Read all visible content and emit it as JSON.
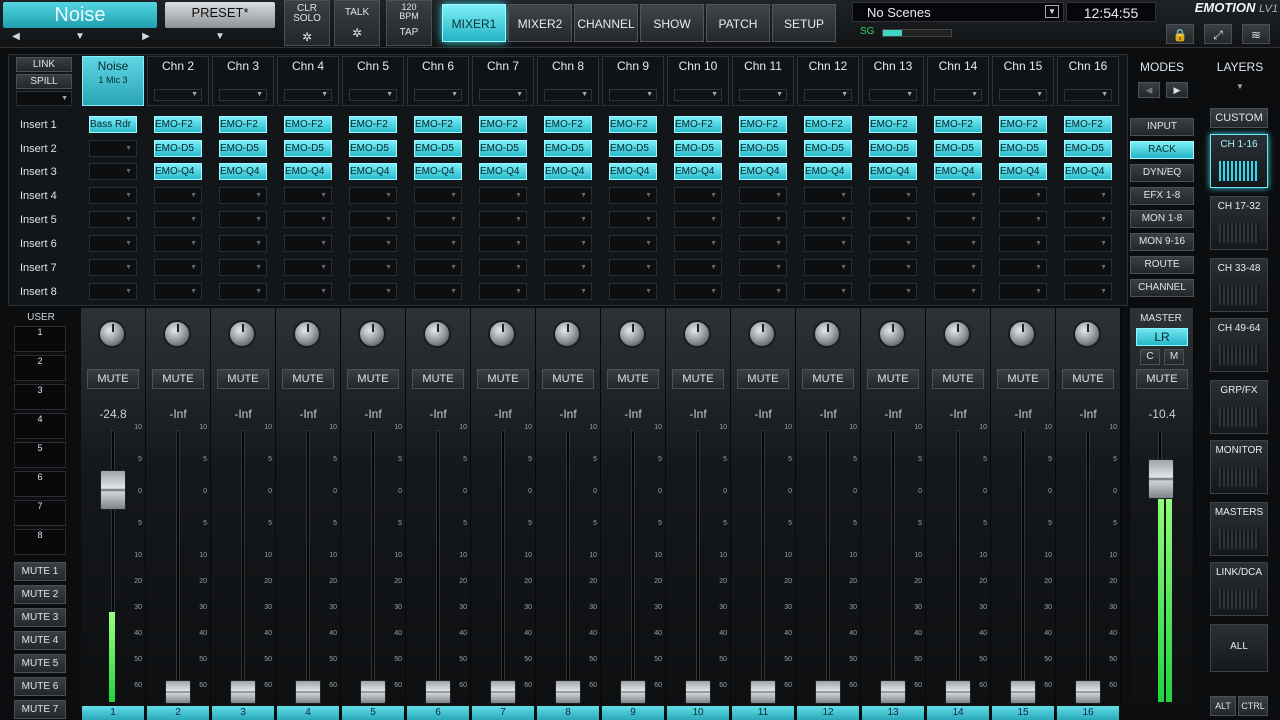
{
  "topbar": {
    "session_name": "Noise",
    "session_prev": "◀",
    "session_menu": "▼",
    "session_next": "▶",
    "preset": "PRESET*",
    "preset_menu": "▼",
    "clr_solo": "CLR\nSOLO",
    "talk": "TALK",
    "bpm": "120\nBPM",
    "tap": "TAP",
    "gear": "✲",
    "tabs": [
      "MIXER1",
      "MIXER2",
      "CHANNEL",
      "SHOW",
      "PATCH",
      "SETUP"
    ],
    "active_tab": "MIXER1",
    "scene": "No Scenes",
    "scene_drop": "▼",
    "clock": "12:54:55",
    "sg": "SG",
    "sg_level": 0.28,
    "logo": "EMOTION",
    "logo_suffix": "LV1",
    "icons": [
      "lock-icon",
      "expand-icon",
      "waves-icon"
    ],
    "icon_glyphs": [
      "🔒",
      "⤢",
      "≋"
    ]
  },
  "left": {
    "link": "LINK",
    "spill": "SPILL",
    "spill_menu": "▼",
    "insert_labels": [
      "Insert 1",
      "Insert 2",
      "Insert 3",
      "Insert 4",
      "Insert 5",
      "Insert 6",
      "Insert 7",
      "Insert 8"
    ],
    "user": "USER",
    "user_slots": [
      "1",
      "2",
      "3",
      "4",
      "5",
      "6",
      "7",
      "8"
    ],
    "mute_groups": [
      "MUTE 1",
      "MUTE 2",
      "MUTE 3",
      "MUTE 4",
      "MUTE 5",
      "MUTE 6",
      "MUTE 7"
    ]
  },
  "channels": [
    {
      "name": "Noise",
      "sub": "1 Mic 3",
      "num": "1",
      "level": "-24.8",
      "inserts": [
        "Bass Rdr",
        "",
        "",
        "",
        "",
        "",
        "",
        ""
      ]
    },
    {
      "name": "Chn 2",
      "sub": "",
      "num": "2",
      "level": "-Inf",
      "inserts": [
        "EMO-F2",
        "EMO-D5",
        "EMO-Q4",
        "",
        "",
        "",
        "",
        ""
      ]
    },
    {
      "name": "Chn 3",
      "sub": "",
      "num": "3",
      "level": "-Inf",
      "inserts": [
        "EMO-F2",
        "EMO-D5",
        "EMO-Q4",
        "",
        "",
        "",
        "",
        ""
      ]
    },
    {
      "name": "Chn 4",
      "sub": "",
      "num": "4",
      "level": "-Inf",
      "inserts": [
        "EMO-F2",
        "EMO-D5",
        "EMO-Q4",
        "",
        "",
        "",
        "",
        ""
      ]
    },
    {
      "name": "Chn 5",
      "sub": "",
      "num": "5",
      "level": "-Inf",
      "inserts": [
        "EMO-F2",
        "EMO-D5",
        "EMO-Q4",
        "",
        "",
        "",
        "",
        ""
      ]
    },
    {
      "name": "Chn 6",
      "sub": "",
      "num": "6",
      "level": "-Inf",
      "inserts": [
        "EMO-F2",
        "EMO-D5",
        "EMO-Q4",
        "",
        "",
        "",
        "",
        ""
      ]
    },
    {
      "name": "Chn 7",
      "sub": "",
      "num": "7",
      "level": "-Inf",
      "inserts": [
        "EMO-F2",
        "EMO-D5",
        "EMO-Q4",
        "",
        "",
        "",
        "",
        ""
      ]
    },
    {
      "name": "Chn 8",
      "sub": "",
      "num": "8",
      "level": "-Inf",
      "inserts": [
        "EMO-F2",
        "EMO-D5",
        "EMO-Q4",
        "",
        "",
        "",
        "",
        ""
      ]
    },
    {
      "name": "Chn 9",
      "sub": "",
      "num": "9",
      "level": "-Inf",
      "inserts": [
        "EMO-F2",
        "EMO-D5",
        "EMO-Q4",
        "",
        "",
        "",
        "",
        ""
      ]
    },
    {
      "name": "Chn 10",
      "sub": "",
      "num": "10",
      "level": "-Inf",
      "inserts": [
        "EMO-F2",
        "EMO-D5",
        "EMO-Q4",
        "",
        "",
        "",
        "",
        ""
      ]
    },
    {
      "name": "Chn 11",
      "sub": "",
      "num": "11",
      "level": "-Inf",
      "inserts": [
        "EMO-F2",
        "EMO-D5",
        "EMO-Q4",
        "",
        "",
        "",
        "",
        ""
      ]
    },
    {
      "name": "Chn 12",
      "sub": "",
      "num": "12",
      "level": "-Inf",
      "inserts": [
        "EMO-F2",
        "EMO-D5",
        "EMO-Q4",
        "",
        "",
        "",
        "",
        ""
      ]
    },
    {
      "name": "Chn 13",
      "sub": "",
      "num": "13",
      "level": "-Inf",
      "inserts": [
        "EMO-F2",
        "EMO-D5",
        "EMO-Q4",
        "",
        "",
        "",
        "",
        ""
      ]
    },
    {
      "name": "Chn 14",
      "sub": "",
      "num": "14",
      "level": "-Inf",
      "inserts": [
        "EMO-F2",
        "EMO-D5",
        "EMO-Q4",
        "",
        "",
        "",
        "",
        ""
      ]
    },
    {
      "name": "Chn 15",
      "sub": "",
      "num": "15",
      "level": "-Inf",
      "inserts": [
        "EMO-F2",
        "EMO-D5",
        "EMO-Q4",
        "",
        "",
        "",
        "",
        ""
      ]
    },
    {
      "name": "Chn 16",
      "sub": "",
      "num": "16",
      "level": "-Inf",
      "inserts": [
        "EMO-F2",
        "EMO-D5",
        "EMO-Q4",
        "",
        "",
        "",
        "",
        ""
      ]
    }
  ],
  "ch1_meter_fraction": 0.33,
  "ch1_fader_fraction": 0.78,
  "mute_label": "MUTE",
  "fader_scale": [
    "10",
    "5",
    "0",
    "5",
    "10",
    "20",
    "30",
    "40",
    "50",
    "60"
  ],
  "modes": {
    "title": "MODES",
    "prev": "◀",
    "next": "▶",
    "items": [
      "INPUT",
      "RACK",
      "DYN/EQ",
      "EFX 1-8",
      "MON 1-8",
      "MON 9-16",
      "ROUTE",
      "CHANNEL"
    ],
    "active": "RACK"
  },
  "master": {
    "label": "MASTER",
    "bus": "LR",
    "c": "C",
    "m": "M",
    "mute": "MUTE",
    "level": "-10.4",
    "meter_fraction": 0.8,
    "fader_fraction": 0.82
  },
  "layers": {
    "title": "LAYERS",
    "menu": "▼",
    "custom": "CUSTOM",
    "items": [
      "CH 1-16",
      "CH 17-32",
      "CH 33-48",
      "CH 49-64",
      "GRP/FX",
      "MONITOR",
      "MASTERS",
      "LINK/DCA",
      "ALL"
    ],
    "active": "CH 1-16",
    "alt": "ALT",
    "ctrl": "CTRL"
  },
  "colors": {
    "accent": "#2bbccb",
    "meter": "#20d440"
  }
}
